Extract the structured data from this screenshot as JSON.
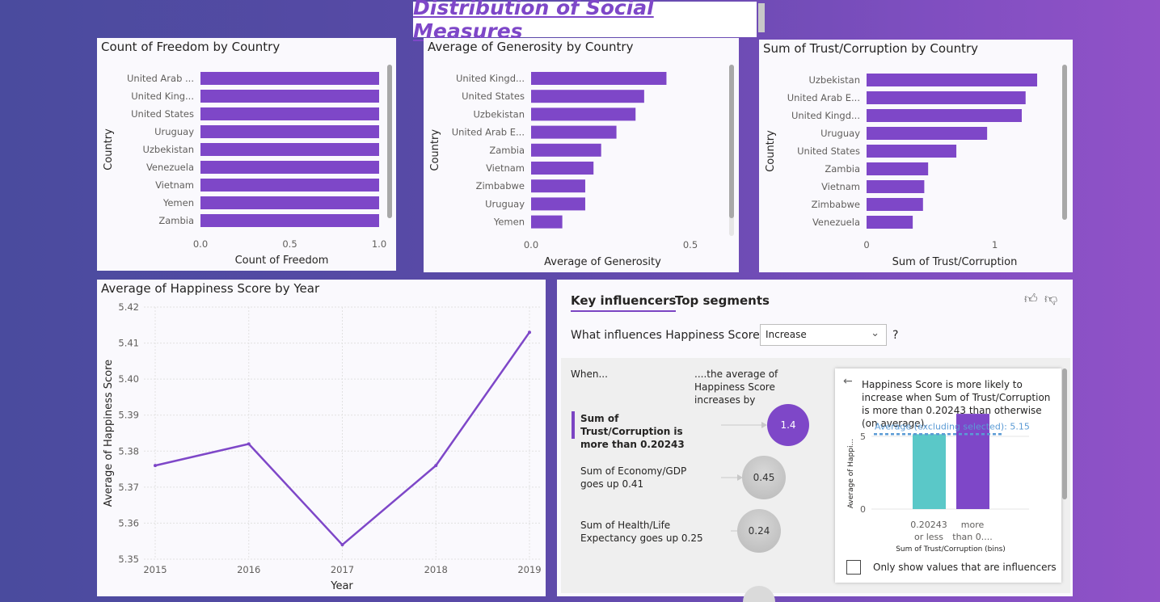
{
  "page_title": "Distribution of Social Measures",
  "colors": {
    "bar": "#7e47c8",
    "line": "#7e47c8",
    "teal": "#5ac8c8",
    "avg_line": "#5b9bd5"
  },
  "charts": {
    "freedom": {
      "title": "Count of Freedom by Country",
      "xlabel": "Count of Freedom",
      "ylabel": "Country",
      "ticks": [
        "0.0",
        "0.5",
        "1.0"
      ]
    },
    "generosity": {
      "title": "Average of Generosity by Country",
      "xlabel": "Average of Generosity",
      "ylabel": "Country",
      "ticks": [
        "0.0",
        "0.5"
      ]
    },
    "trust": {
      "title": "Sum of Trust/Corruption by Country",
      "xlabel": "Sum of Trust/Corruption",
      "ylabel": "Country",
      "ticks": [
        "0",
        "1"
      ]
    },
    "happiness": {
      "title": "Average of Happiness Score by Year",
      "xlabel": "Year",
      "ylabel": "Average of Happiness Score"
    }
  },
  "chart_data": [
    {
      "type": "bar",
      "title": "Count of Freedom by Country",
      "categories": [
        "United Arab ...",
        "United King...",
        "United States",
        "Uruguay",
        "Uzbekistan",
        "Venezuela",
        "Vietnam",
        "Yemen",
        "Zambia"
      ],
      "values": [
        1,
        1,
        1,
        1,
        1,
        1,
        1,
        1,
        1
      ],
      "xlabel": "Count of Freedom",
      "ylabel": "Country",
      "xlim": [
        0,
        1
      ]
    },
    {
      "type": "bar",
      "title": "Average of Generosity by Country",
      "categories": [
        "United Kingd...",
        "United States",
        "Uzbekistan",
        "United Arab E...",
        "Zambia",
        "Vietnam",
        "Zimbabwe",
        "Uruguay",
        "Yemen"
      ],
      "values": [
        0.425,
        0.355,
        0.328,
        0.268,
        0.22,
        0.196,
        0.17,
        0.17,
        0.098
      ],
      "xlabel": "Average of Generosity",
      "ylabel": "Country",
      "xlim": [
        0,
        0.5
      ]
    },
    {
      "type": "bar",
      "title": "Sum of Trust/Corruption by Country",
      "categories": [
        "Uzbekistan",
        "United Arab E...",
        "United Kingd...",
        "Uruguay",
        "United States",
        "Zambia",
        "Vietnam",
        "Zimbabwe",
        "Venezuela"
      ],
      "values": [
        1.33,
        1.24,
        1.21,
        0.94,
        0.7,
        0.48,
        0.45,
        0.44,
        0.36
      ],
      "xlabel": "Sum of Trust/Corruption",
      "ylabel": "Country",
      "xlim": [
        0,
        1.5
      ]
    },
    {
      "type": "line",
      "title": "Average of Happiness Score by Year",
      "x": [
        2015,
        2016,
        2017,
        2018,
        2019
      ],
      "y": [
        5.376,
        5.382,
        5.354,
        5.376,
        5.413
      ],
      "y_ticks": [
        "5.35",
        "5.36",
        "5.37",
        "5.38",
        "5.39",
        "5.40",
        "5.41",
        "5.42"
      ],
      "ylim": [
        5.35,
        5.42
      ],
      "xlabel": "Year",
      "ylabel": "Average of Happiness Score"
    }
  ],
  "key_influencers": {
    "tab_active": "Key influencers",
    "tab_other": "Top segments",
    "question": "What influences Happiness Score to",
    "select_value": "Increase",
    "qmark": "?",
    "when": "When...",
    "then": "....the average of Happiness Score increases by",
    "items": [
      {
        "label": "Sum of Trust/Corruption is more than 0.20243",
        "value": "1.4"
      },
      {
        "label": "Sum of Economy/GDP goes up 0.41",
        "value": "0.45"
      },
      {
        "label": "Sum of Health/Life Expectancy goes up 0.25",
        "value": "0.24"
      }
    ],
    "detail": {
      "text": "Happiness Score is more likely to increase when Sum of Trust/Corruption is more than 0.20243 than otherwise (on average).",
      "avg_label": "Average (excluding selected): 5.15",
      "ylabel": "Average of Happi...",
      "y_ticks": [
        "5",
        "0"
      ],
      "bars": [
        {
          "label_line1": "0.20243",
          "label_line2": "or less",
          "value": 5.15
        },
        {
          "label_line1": "more",
          "label_line2": "than 0....",
          "value": 6.55
        }
      ],
      "xlabel": "Sum of Trust/Corruption (bins)",
      "checkbox_label": "Only show values that are influencers"
    }
  }
}
